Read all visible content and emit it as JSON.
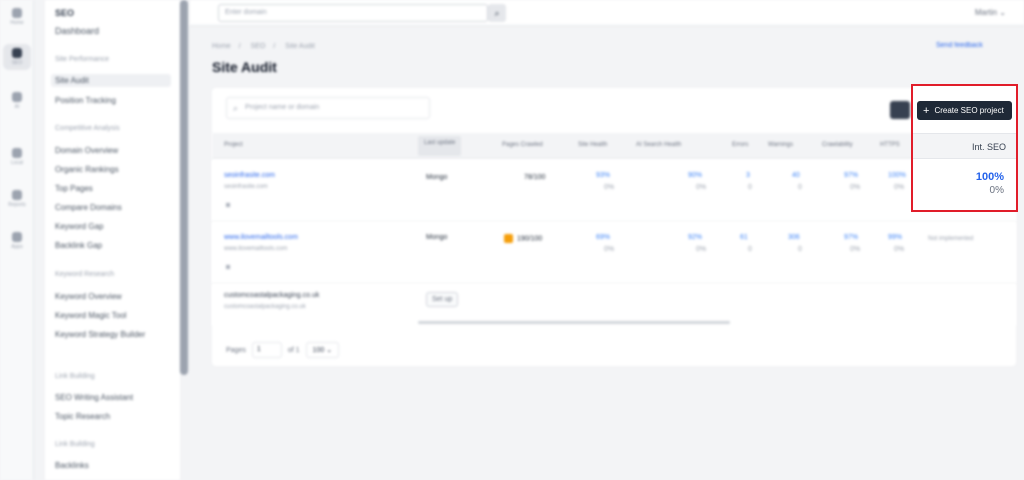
{
  "rail": [
    {
      "label": "Home",
      "icon": "home-icon"
    },
    {
      "label": "SEO",
      "icon": "seo-icon",
      "active": true
    },
    {
      "label": "AI",
      "icon": "ai-icon"
    },
    {
      "label": "Local",
      "icon": "location-icon"
    },
    {
      "label": "Reports",
      "icon": "reports-icon"
    },
    {
      "label": "Apps",
      "icon": "apps-icon"
    }
  ],
  "sidebar": {
    "title": "SEO",
    "dashboard": "Dashboard",
    "groups": [
      {
        "heading": "Site Performance",
        "items": [
          "Site Audit",
          "Position Tracking"
        ],
        "active_index": 0
      },
      {
        "heading": "Competitive Analysis",
        "items": [
          "Domain Overview",
          "Organic Rankings",
          "Top Pages",
          "Compare Domains",
          "Keyword Gap",
          "Backlink Gap"
        ]
      },
      {
        "heading": "Keyword Research",
        "items": [
          "Keyword Overview",
          "Keyword Magic Tool",
          "Keyword Strategy Builder"
        ]
      },
      {
        "heading": "Link Building",
        "items": [
          "SEO Writing Assistant",
          "Topic Research"
        ]
      },
      {
        "heading": "Link Building",
        "items": [
          "Backlinks"
        ]
      }
    ]
  },
  "topbar": {
    "search_placeholder": "Enter domain",
    "user": "Martin"
  },
  "breadcrumb": [
    "Home",
    "SEO",
    "Site Audit"
  ],
  "page_title": "Site Audit",
  "feedback": "Send feedback",
  "project_search_placeholder": "Project name or domain",
  "create_button": "Create SEO project",
  "table": {
    "columns": [
      "Project",
      "Last update",
      "Pages Crawled",
      "Site Health",
      "AI Search Health",
      "Errors",
      "Warnings",
      "Crawlability",
      "HTTPS",
      "Int. SEO"
    ],
    "rows": [
      {
        "domain": "seoinfrasite.com",
        "sub": "seoinfrasite.com",
        "update": "Mongo",
        "pages": "78/100",
        "health": "93%",
        "health_d": "0%",
        "ai": "90%",
        "ai_d": "0%",
        "errors": "3",
        "errors_d": "0",
        "warnings": "40",
        "warnings_d": "0",
        "crawl": "97%",
        "crawl_d": "0%",
        "https": "100%",
        "https_d": "0%",
        "int_seo": "100%",
        "int_seo_d": "0%"
      },
      {
        "domain": "www.ilovemailtools.com",
        "sub": "www.ilovemailtools.com",
        "update": "Mongo",
        "pages": "190/100",
        "health": "69%",
        "health_d": "0%",
        "ai": "92%",
        "ai_d": "0%",
        "errors": "61",
        "errors_d": "0",
        "warnings": "306",
        "warnings_d": "0",
        "crawl": "97%",
        "crawl_d": "0%",
        "https": "99%",
        "https_d": "0%",
        "int_seo": "Not implemented",
        "int_seo_d": ""
      },
      {
        "domain": "customcoastalpackaging.co.uk",
        "sub": "customcoastalpackaging.co.uk",
        "update": "Set up"
      }
    ]
  },
  "pager": {
    "label": "Pages",
    "page": "1",
    "of": "of 1",
    "per_page": "100"
  },
  "highlight": {
    "column": "Int. SEO",
    "value": "100%",
    "delta": "0%"
  }
}
